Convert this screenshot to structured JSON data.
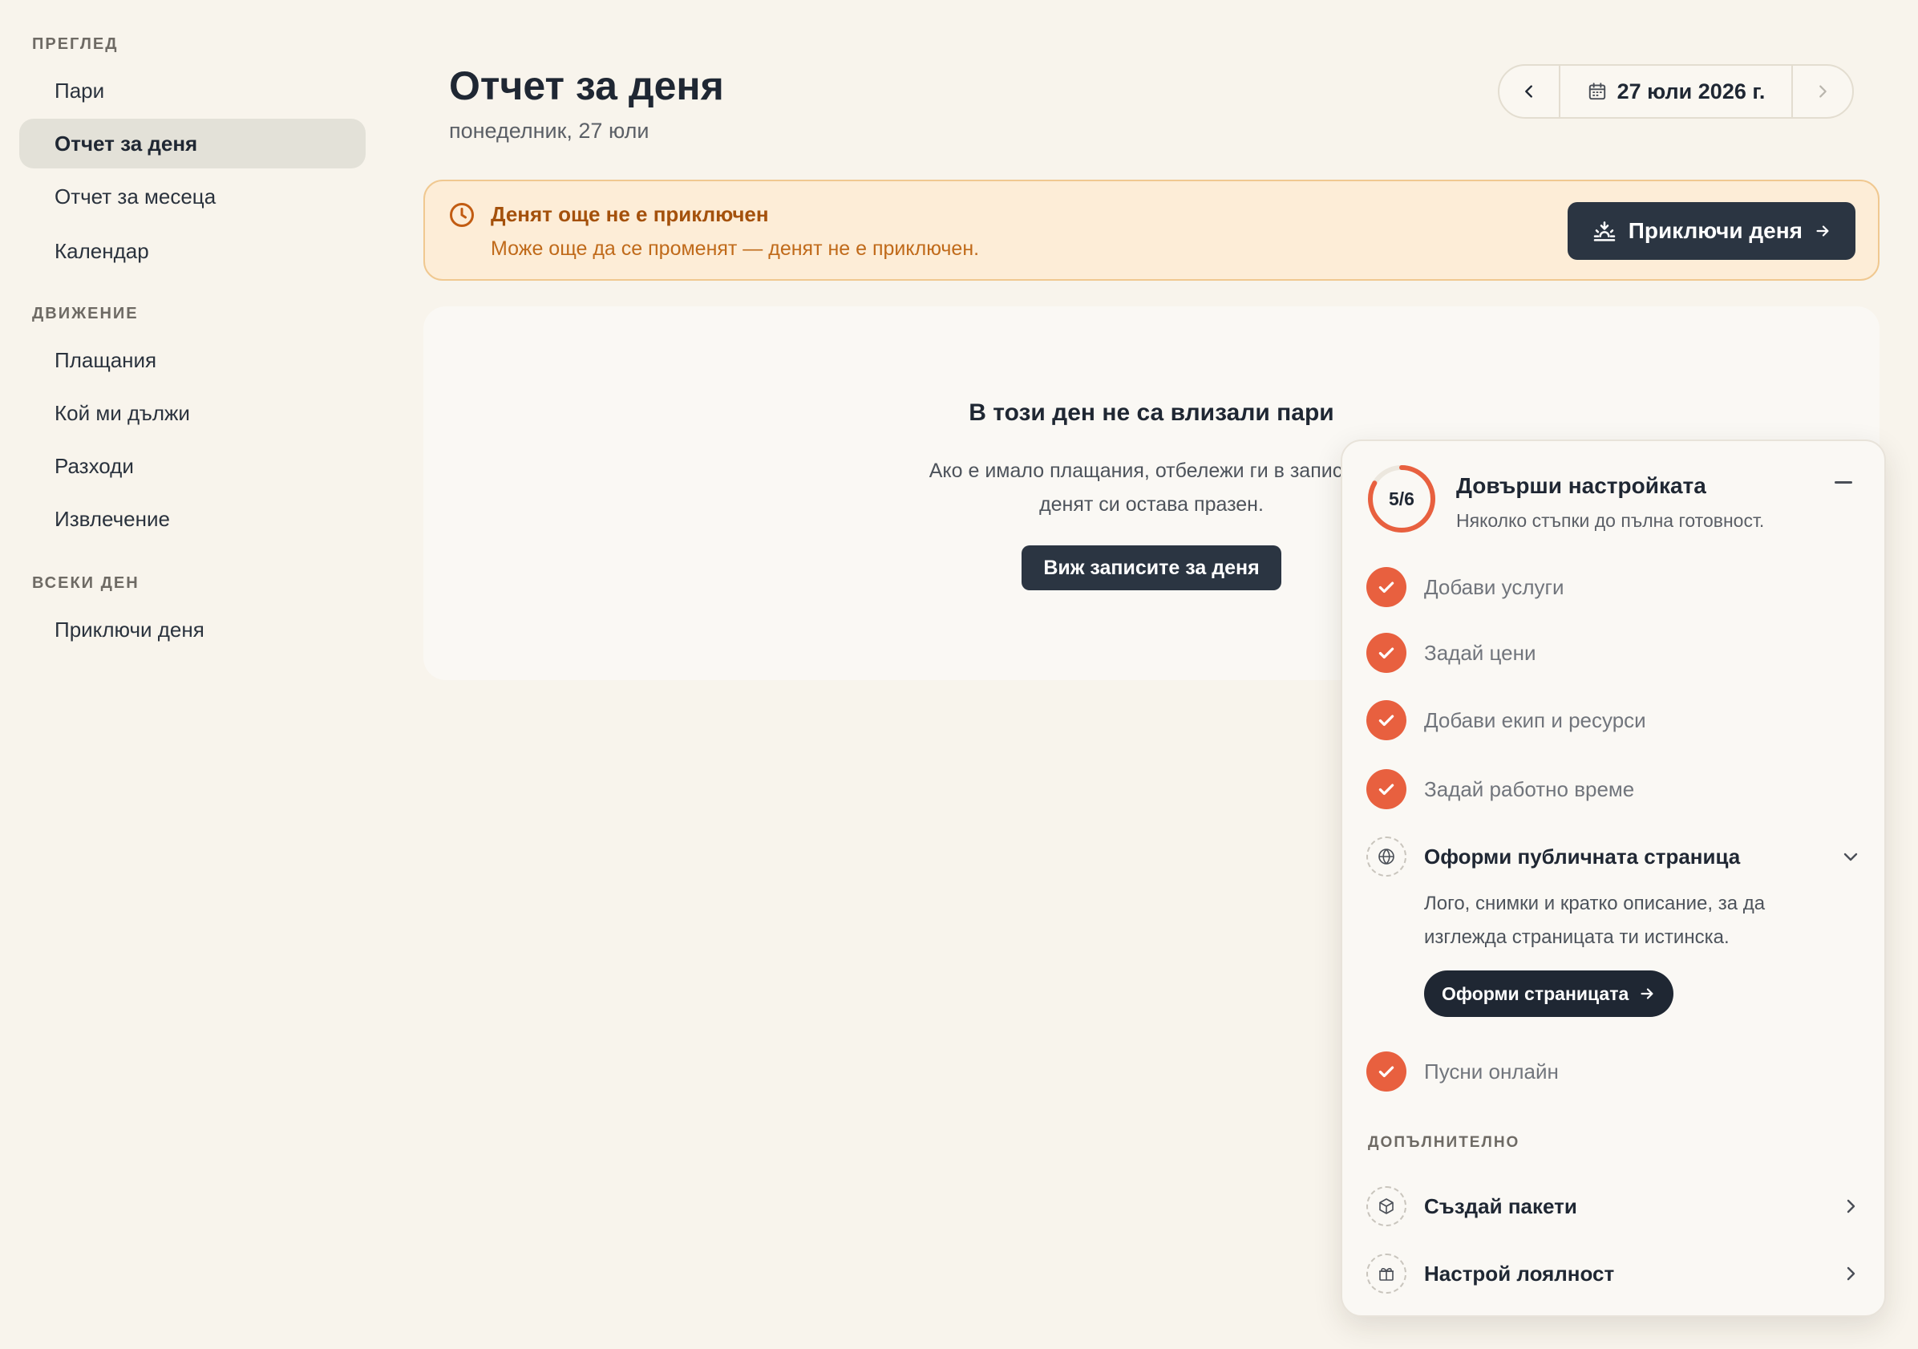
{
  "sidebar": {
    "sections": [
      {
        "title": "ПРЕГЛЕД",
        "items": [
          "Пари",
          "Отчет за деня",
          "Отчет за месеца",
          "Календар"
        ]
      },
      {
        "title": "ДВИЖЕНИЕ",
        "items": [
          "Плащания",
          "Кой ми дължи",
          "Разходи",
          "Извлечение"
        ]
      },
      {
        "title": "ВСЕКИ ДЕН",
        "items": [
          "Приключи деня"
        ]
      }
    ],
    "active_item": "Отчет за деня"
  },
  "header": {
    "title": "Отчет за деня",
    "subtitle": "понеделник, 27 юли",
    "date_label": "27 юли 2026 г."
  },
  "banner": {
    "title": "Денят още не е приключен",
    "text": "Може още да се променят — денят не е приключен.",
    "button": "Приключи деня"
  },
  "empty_state": {
    "title": "В този ден не са влизали пари",
    "text_line1": "Ако е имало плащания, отбележи ги в записите",
    "text_line2": "денят си остава празен.",
    "button": "Виж записите за деня"
  },
  "setup": {
    "progress_label": "5/6",
    "progress_fraction": 0.833,
    "title": "Довърши настройката",
    "subtitle": "Няколко стъпки до пълна готовност.",
    "steps": [
      {
        "label": "Добави услуги",
        "done": true
      },
      {
        "label": "Задай цени",
        "done": true
      },
      {
        "label": "Добави екип и ресурси",
        "done": true
      },
      {
        "label": "Задай работно време",
        "done": true
      },
      {
        "label": "Оформи публичната страница",
        "done": false
      },
      {
        "label": "Пусни онлайн",
        "done": true
      }
    ],
    "current_desc_line1": "Лого, снимки и кратко описание, за да",
    "current_desc_line2": "изглежда страницата ти истинска.",
    "current_button": "Оформи страницата",
    "extra_title": "ДОПЪЛНИТЕЛНО",
    "extras": [
      "Създай пакети",
      "Настрой лоялност"
    ]
  },
  "colors": {
    "accent": "#e8603f",
    "dark_button": "#2b3542",
    "banner_bg": "#fdedd7",
    "banner_text": "#a4510c",
    "page_bg": "#f8f4ec"
  }
}
